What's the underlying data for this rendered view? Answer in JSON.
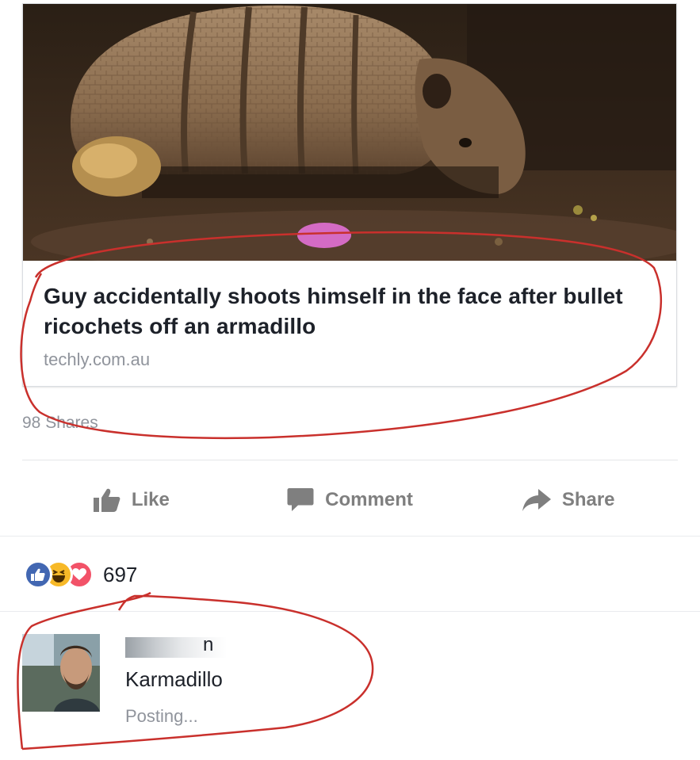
{
  "link_preview": {
    "image_alt": "Armadillo on dirt",
    "title": "Guy accidentally shoots himself in the face after bullet ricochets off an armadillo",
    "domain": "techly.com.au"
  },
  "shares": "98 Shares",
  "actions": {
    "like": "Like",
    "comment": "Comment",
    "share": "Share"
  },
  "reactions": {
    "icons": [
      "like-icon",
      "haha-icon",
      "love-icon"
    ],
    "count": "697"
  },
  "comment": {
    "author_visible": "n",
    "text": "Karmadillo",
    "status": "Posting..."
  },
  "colors": {
    "like_blue": "#4267b2",
    "haha_yellow": "#f7b928",
    "love_red": "#f25268",
    "annotation_red": "#c9302c",
    "muted_gray": "#90949c"
  }
}
